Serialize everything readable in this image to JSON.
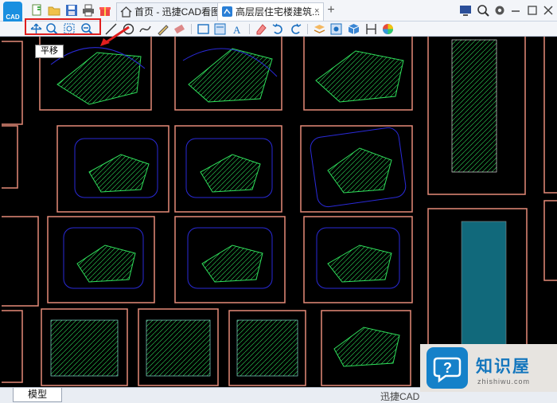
{
  "app": {
    "logo_text": "CAD"
  },
  "tabs": [
    {
      "label": "首页 - 迅捷CAD看图",
      "active": false
    },
    {
      "label": "高层层住宅楼建筑...",
      "active": true
    }
  ],
  "tab_close": "×",
  "tab_add": "+",
  "toolbar": {
    "groups": [
      [
        "pan-icon",
        "zoom-icon",
        "zoom-window-icon",
        "zoom-realtime-icon"
      ],
      [
        "line-icon",
        "circle-icon",
        "curve-icon",
        "pen-icon",
        "eraser-markup-icon"
      ],
      [
        "rectangle-icon",
        "cloud-icon",
        "text-icon"
      ],
      [
        "erase-icon",
        "undo-icon",
        "redo-icon"
      ],
      [
        "layer-icon",
        "grid-icon",
        "3d-icon",
        "dimension-icon",
        "color-icon"
      ]
    ]
  },
  "tooltip": {
    "text": "平移"
  },
  "bottom": {
    "model_tab": "模型",
    "status_text": "迅捷CAD"
  },
  "watermark": {
    "title": "知识屋",
    "url": "zhishiwu.com"
  },
  "colors": {
    "highlight": "#e01e1e",
    "sheet_border": "#e58a78",
    "canvas": "#000000",
    "accent": "#1a8fe0"
  }
}
